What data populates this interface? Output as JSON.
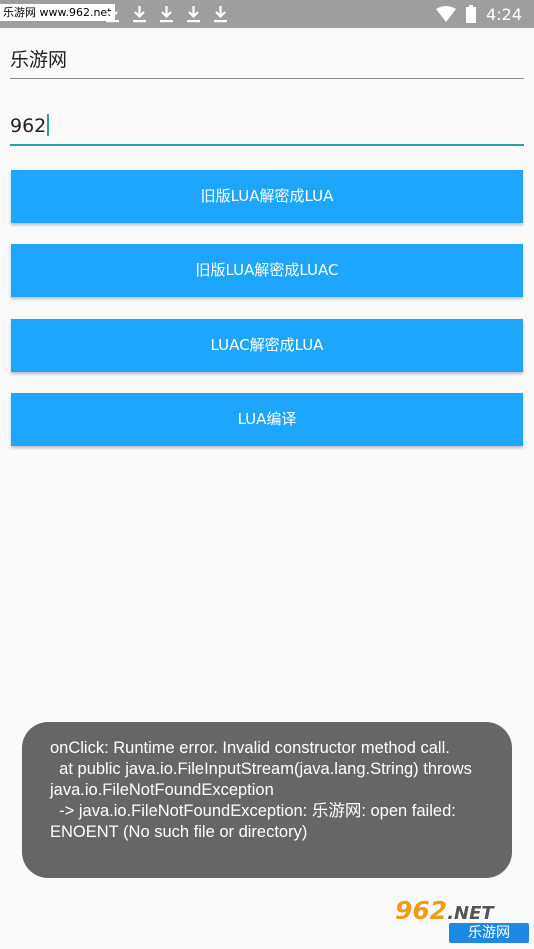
{
  "status_bar": {
    "watermark": "乐游网 www.962.net",
    "time": "4:24",
    "download_icons": [
      "download-icon",
      "download-icon",
      "download-icon",
      "download-icon",
      "download-icon"
    ]
  },
  "form": {
    "path_value": "乐游网",
    "key_value": "962"
  },
  "buttons": {
    "b1": "旧版LUA解密成LUA",
    "b2": "旧版LUA解密成LUAC",
    "b3": "LUAC解密成LUA",
    "b4": "LUA编译"
  },
  "toast": {
    "lines": [
      "onClick: Runtime error. Invalid constructor method call.",
      "  at public java.io.FileInputStream(java.lang.String) throws",
      "java.io.FileNotFoundException",
      "  -> java.io.FileNotFoundException: 乐游网: open failed:",
      "ENOENT (No such file or directory)"
    ]
  },
  "logo": {
    "top_text": "962",
    "net_text": ".NET",
    "bottom_text": "乐游网"
  },
  "colors": {
    "accent": "#1ea6ff",
    "focus_underline": "#26a69a",
    "status_bar": "#9e9e9e",
    "toast_bg": "#666666"
  }
}
